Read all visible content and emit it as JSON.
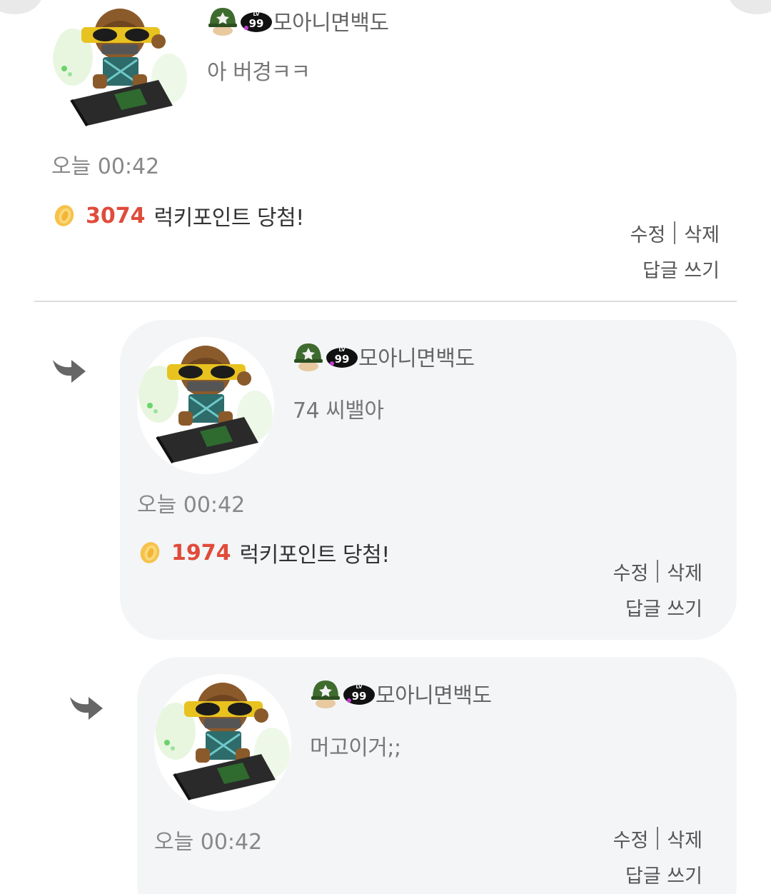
{
  "comments": [
    {
      "author": "모아니면백도",
      "level": "99",
      "level_prefix": "LV",
      "text": "아 버경ㅋㅋ",
      "time": "오늘 00:42",
      "lucky_points": "3074",
      "lucky_text": "럭키포인트 당첨!",
      "edit": "수정",
      "delete": "삭제",
      "reply": "답글 쓰기"
    },
    {
      "author": "모아니면백도",
      "level": "99",
      "level_prefix": "LV",
      "text": "74 씨밸아",
      "time": "오늘 00:42",
      "lucky_points": "1974",
      "lucky_text": "럭키포인트 당첨!",
      "edit": "수정",
      "delete": "삭제",
      "reply": "답글 쓰기"
    },
    {
      "author": "모아니면백도",
      "level": "99",
      "level_prefix": "LV",
      "text": "머고이거;;",
      "time": "오늘 00:42",
      "edit": "수정",
      "delete": "삭제",
      "reply": "답글 쓰기"
    }
  ],
  "colors": {
    "lucky_points": "#e04b3a",
    "reply_bg": "#f3f5f7",
    "meta_text": "#888888"
  },
  "icons": {
    "helmet": "helmet-icon",
    "level_badge": "level-badge-icon",
    "coin": "coin-icon",
    "reply_arrow": "reply-arrow-icon"
  }
}
